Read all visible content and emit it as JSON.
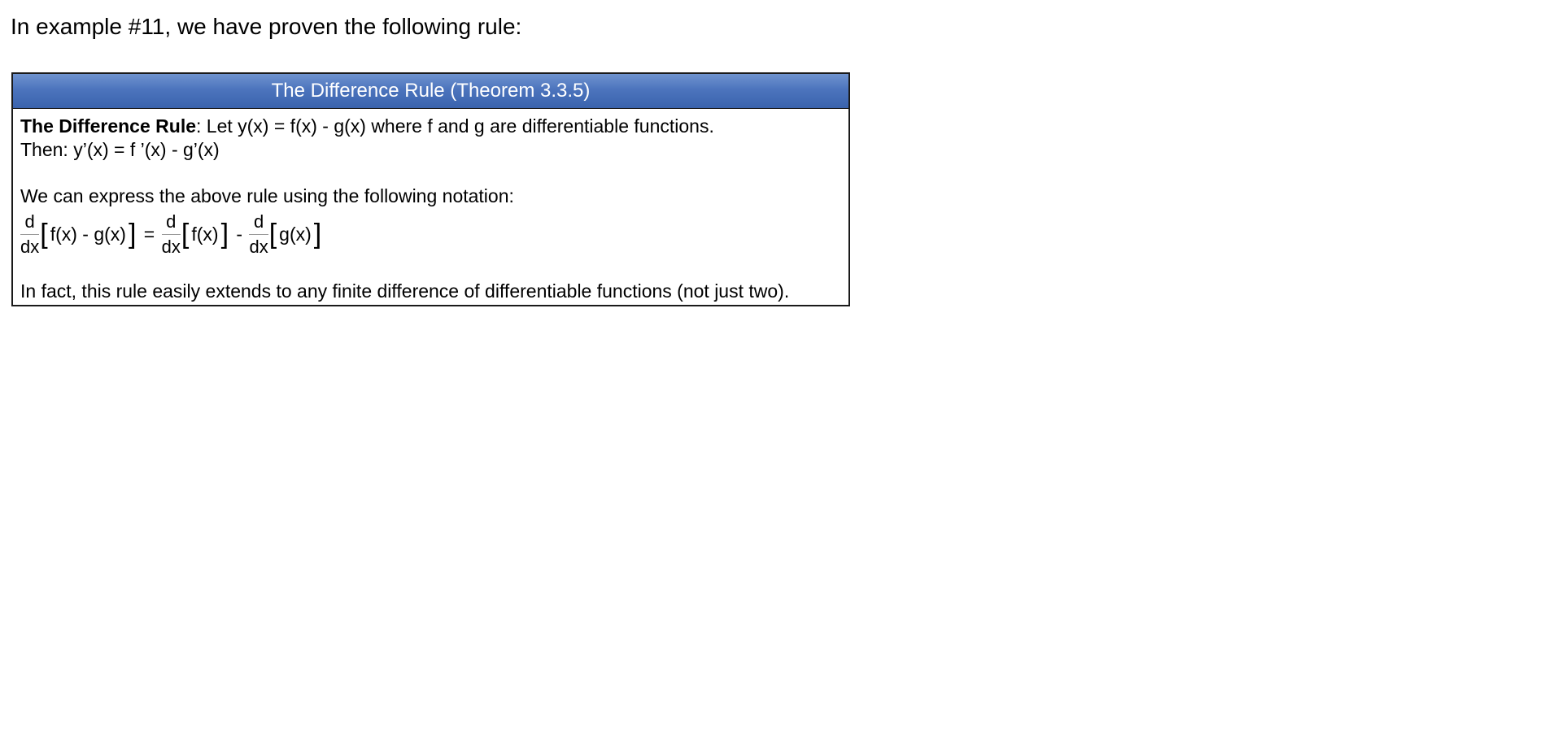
{
  "intro_text": "In example #11, we have proven the following rule:",
  "theorem": {
    "header": "The Difference Rule (Theorem 3.3.5)",
    "bold_lead": "The Difference Rule",
    "line1_rest": ": Let y(x) = f(x) - g(x) where f and g are differentiable functions.",
    "line2": "Then:  y’(x) = f ’(x) - g’(x)",
    "line3": "We can express the above rule using the following notation:",
    "formula": {
      "frac_num": "d",
      "frac_den": "dx",
      "open_bracket": "[",
      "close_bracket": "]",
      "term1": "f(x) - g(x)",
      "equals": " = ",
      "term2": "f(x)",
      "minus": " - ",
      "term3": "g(x)"
    },
    "line4": "In fact, this rule easily extends to any finite difference of differentiable functions (not just two)."
  },
  "colors": {
    "header_top": "#6f93cf",
    "header_bottom": "#3a63ad",
    "border": "#1a1a1a"
  }
}
